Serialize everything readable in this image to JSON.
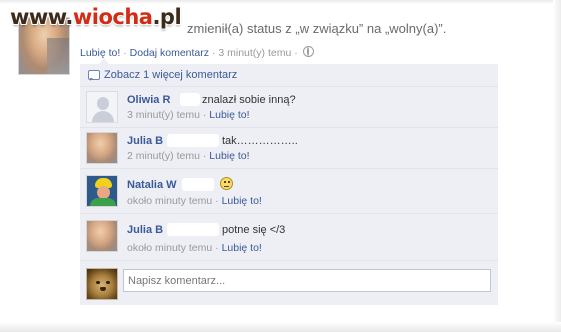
{
  "watermark": {
    "prefix": "www.",
    "brand": "wiocha",
    "suffix": ".pl"
  },
  "post": {
    "status_text": "zmienił(a) status z „w związku” na „wolny(a)”.",
    "like_label": "Lubię to!",
    "comment_label": "Dodaj komentarz",
    "separator": "·",
    "time": "3 minut(y) temu",
    "privacy_icon": "globe-icon"
  },
  "comments": {
    "more_label": "Zobacz 1 więcej komentarz",
    "more_icon": "speech-bubble-icon",
    "items": [
      {
        "name": "Oliwia R",
        "text": "znalazł sobie inną?",
        "time": "3 minut(y) temu",
        "like": "Lubię to!",
        "avatar": "default-silhouette-avatar"
      },
      {
        "name": "Julia B",
        "text": "tak……………..",
        "time": "2 minut(y) temu",
        "like": "Lubię to!",
        "avatar": "julia-avatar"
      },
      {
        "name": "Natalia W",
        "text": "",
        "emoticon": "frown-emoticon",
        "time": "około minuty temu",
        "like": "Lubię to!",
        "avatar": "natalia-avatar"
      },
      {
        "name": "Julia B",
        "text": "potne się </3",
        "time": "około minuty temu",
        "like": "Lubię to!",
        "avatar": "julia-avatar"
      }
    ],
    "write_placeholder": "Napisz komentarz..."
  },
  "colors": {
    "link": "#3b5998",
    "panel": "#edeff4",
    "meta": "#999999"
  }
}
